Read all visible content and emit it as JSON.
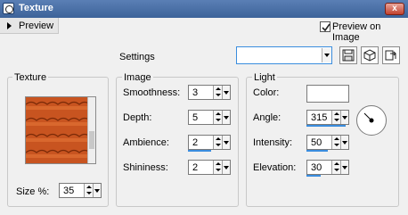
{
  "window": {
    "title": "Texture",
    "close_label": "x"
  },
  "toolbar": {
    "preview_label": "Preview",
    "preview_on_image_label": "Preview on Image",
    "preview_on_image_checked": true
  },
  "settings": {
    "label": "Settings",
    "value": ""
  },
  "texture": {
    "group_label": "Texture",
    "size_label": "Size %:",
    "size_value": "35"
  },
  "image": {
    "group_label": "Image",
    "smoothness_label": "Smoothness:",
    "smoothness_value": "3",
    "depth_label": "Depth:",
    "depth_value": "5",
    "ambience_label": "Ambience:",
    "ambience_value": "2",
    "shininess_label": "Shininess:",
    "shininess_value": "2"
  },
  "light": {
    "group_label": "Light",
    "color_label": "Color:",
    "color_value": "#ffffff",
    "angle_label": "Angle:",
    "angle_value": "315",
    "intensity_label": "Intensity:",
    "intensity_value": "50",
    "elevation_label": "Elevation:",
    "elevation_value": "30"
  },
  "colors": {
    "accent": "#3a8dde",
    "tile": "#d2581f",
    "titlebar": "#3d6399"
  }
}
